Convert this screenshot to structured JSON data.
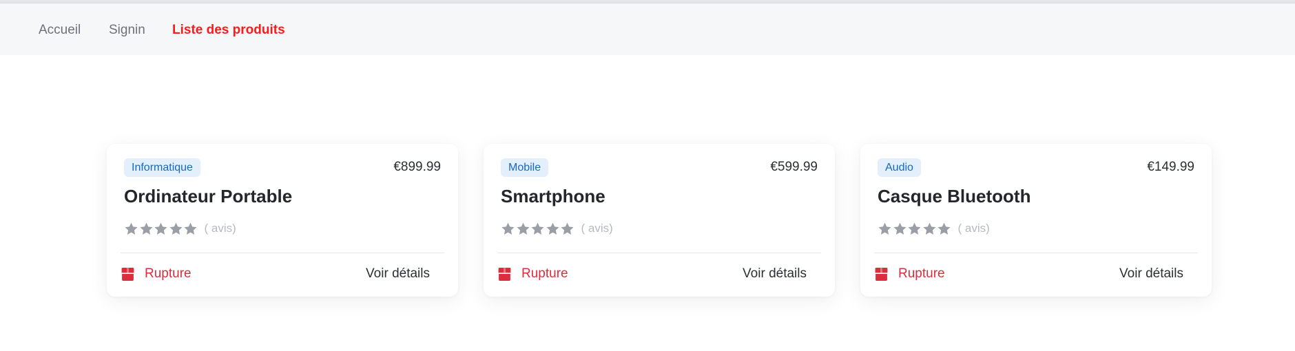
{
  "nav": {
    "links": [
      {
        "label": "Accueil",
        "active": false
      },
      {
        "label": "Signin",
        "active": false
      },
      {
        "label": "Liste des produits",
        "active": true
      }
    ]
  },
  "products": [
    {
      "category": "Informatique",
      "price": "€899.99",
      "name": "Ordinateur Portable",
      "stars": 5,
      "reviews_label": "( avis)",
      "status": "Rupture",
      "action": "Voir détails"
    },
    {
      "category": "Mobile",
      "price": "€599.99",
      "name": "Smartphone",
      "stars": 5,
      "reviews_label": "( avis)",
      "status": "Rupture",
      "action": "Voir détails"
    },
    {
      "category": "Audio",
      "price": "€149.99",
      "name": "Casque Bluetooth",
      "stars": 5,
      "reviews_label": "( avis)",
      "status": "Rupture",
      "action": "Voir détails"
    }
  ],
  "colors": {
    "active_link": "#ff1a1a",
    "badge_text": "#1669c2",
    "badge_bg": "#e3effb",
    "out_of_stock": "#dc2d3c",
    "star": "#9a9ea6"
  }
}
